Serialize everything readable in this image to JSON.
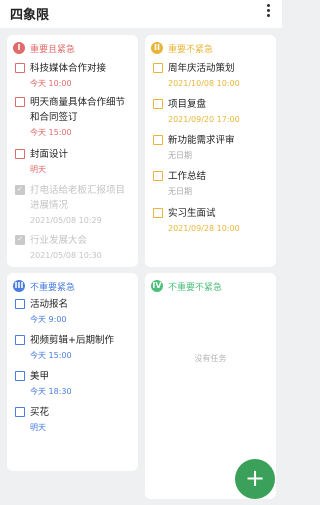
{
  "app": {
    "title": "四象限"
  },
  "colors": {
    "q1": "#e06b6b",
    "q2": "#e8b53a",
    "q3": "#4a7de0",
    "q4": "#4cbf7a",
    "fab": "#3aa05a",
    "meta_gray": "#aaaaaa"
  },
  "quadrants": [
    {
      "badge": "I",
      "title": "重要且紧急",
      "tasks": [
        {
          "title": "科技媒体合作对接",
          "time": "今天 10:00",
          "done": false
        },
        {
          "title": "明天商量具体合作细节和合同签订",
          "time": "今天 15:00",
          "done": false
        },
        {
          "title": "封面设计",
          "time": "明天",
          "done": false
        },
        {
          "title": "打电话给老板汇报项目进展情况",
          "time": "2021/05/08 10:29",
          "done": true
        },
        {
          "title": "行业发展大会",
          "time": "2021/05/08 10:30",
          "done": true
        }
      ]
    },
    {
      "badge": "II",
      "title": "重要不紧急",
      "tasks": [
        {
          "title": "周年庆活动策划",
          "time": "2021/10/08 10:00",
          "done": false
        },
        {
          "title": "项目复盘",
          "time": "2021/09/20 17:00",
          "done": false
        },
        {
          "title": "新功能需求评审",
          "time": "无日期",
          "done": false
        },
        {
          "title": "工作总结",
          "time": "无日期",
          "done": false
        },
        {
          "title": "实习生面试",
          "time": "2021/09/28 10:00",
          "done": false
        }
      ]
    },
    {
      "badge": "III",
      "title": "不重要紧急",
      "tasks": [
        {
          "title": "活动报名",
          "time": "今天 9:00",
          "done": false
        },
        {
          "title": "视频剪辑+后期制作",
          "time": "今天 15:00",
          "done": false
        },
        {
          "title": "美甲",
          "time": "今天 18:30",
          "done": false
        },
        {
          "title": "买花",
          "time": "明天",
          "done": false
        }
      ]
    },
    {
      "badge": "IV",
      "title": "不重要不紧急",
      "tasks": [],
      "empty_text": "没有任务"
    }
  ],
  "fab": {
    "label": "+"
  }
}
